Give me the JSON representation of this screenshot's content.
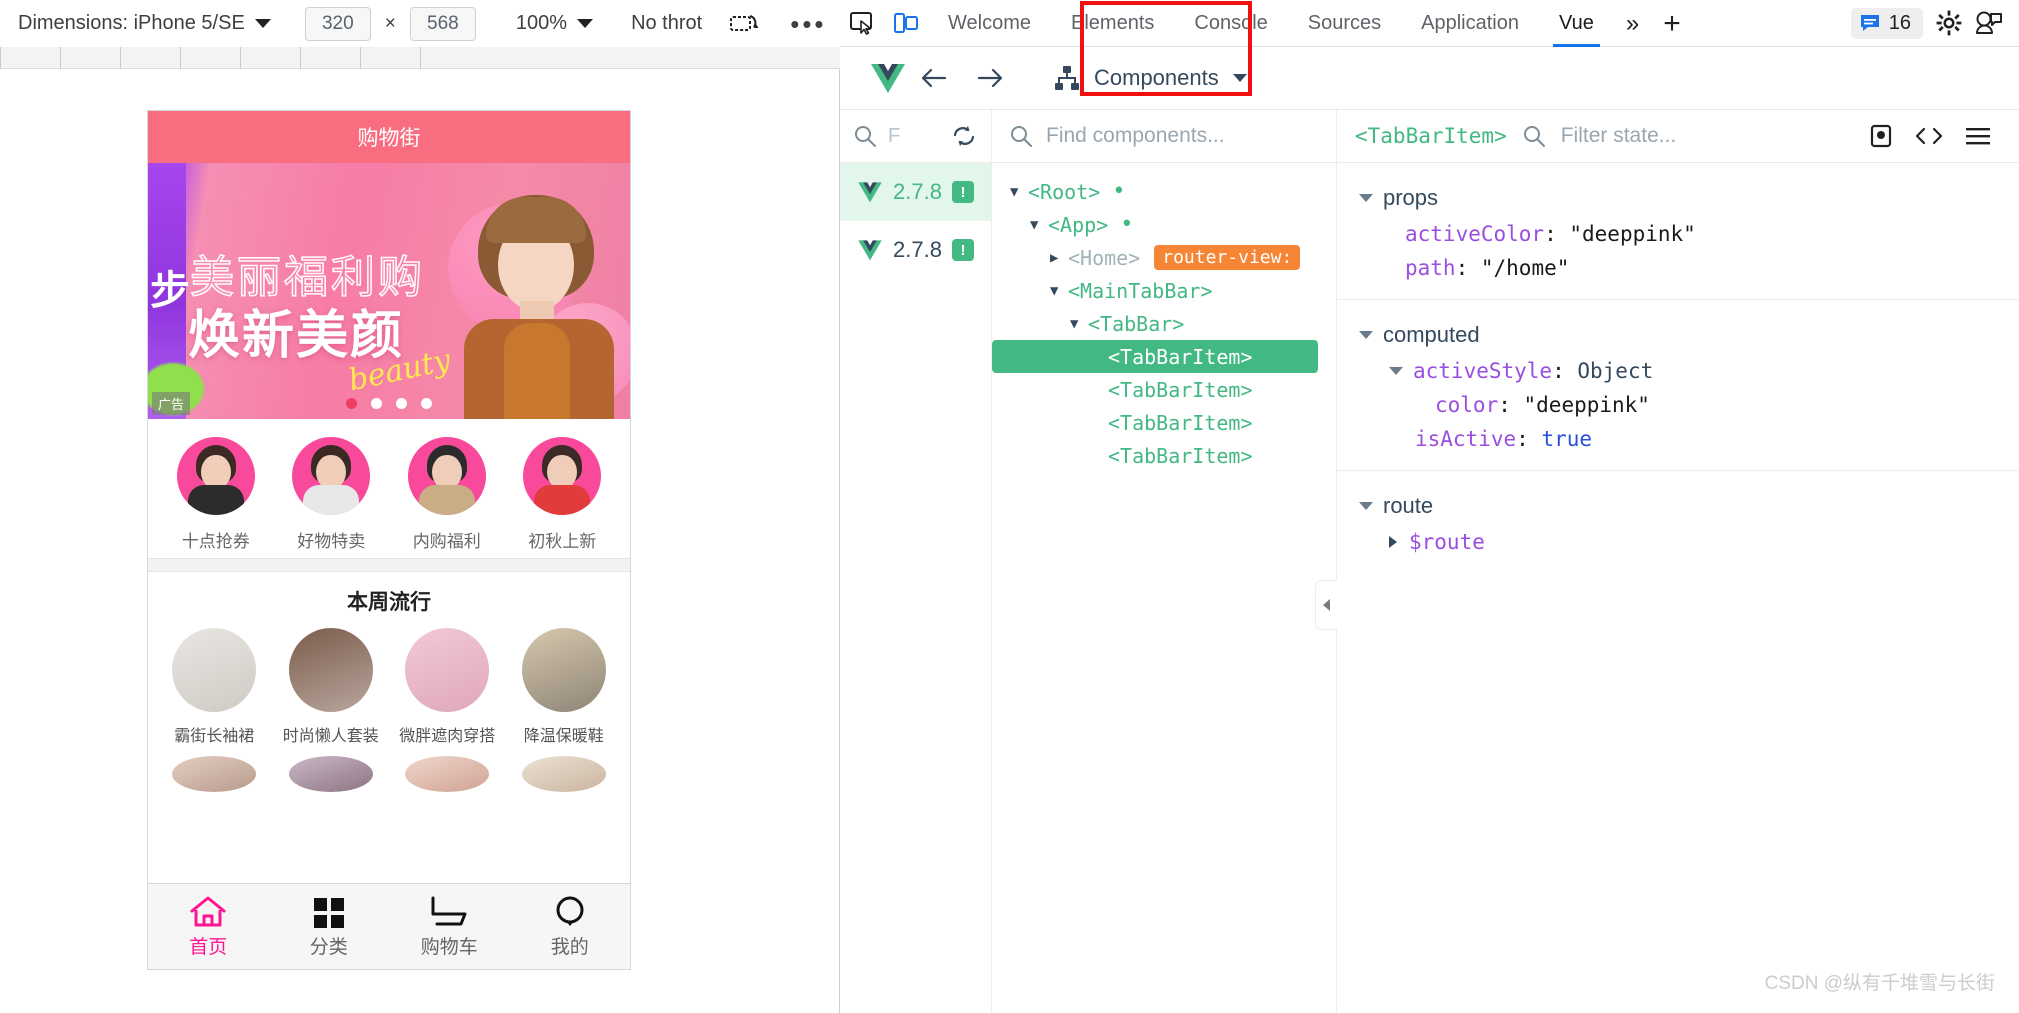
{
  "device_toolbar": {
    "dimensions_label": "Dimensions: iPhone 5/SE",
    "width_value": "320",
    "multiply": "×",
    "height_value": "568",
    "zoom_value": "100%",
    "throttle_label": "No throt",
    "rotate_icon": "rotate-device-icon",
    "more_icon": "more-options-icon"
  },
  "phone": {
    "header_title": "购物街",
    "banner": {
      "headline_outline": "美丽福利购",
      "headline_solid": "焕新美颜",
      "script_text": "beauty",
      "ad_label": "广告",
      "purple_glyph": "步",
      "dot_count": 4,
      "active_dot": 0
    },
    "categories": [
      {
        "label": "十点抢券"
      },
      {
        "label": "好物特卖"
      },
      {
        "label": "内购福利"
      },
      {
        "label": "初秋上新"
      }
    ],
    "popular_title": "本周流行",
    "popular": [
      {
        "label": "霸街长袖裙"
      },
      {
        "label": "时尚懒人套装"
      },
      {
        "label": "微胖遮肉穿搭"
      },
      {
        "label": "降温保暖鞋"
      }
    ],
    "tabbar": [
      {
        "label": "首页",
        "icon": "home-icon",
        "active": true
      },
      {
        "label": "分类",
        "icon": "grid-icon",
        "active": false
      },
      {
        "label": "购物车",
        "icon": "cart-icon",
        "active": false
      },
      {
        "label": "我的",
        "icon": "profile-icon",
        "active": false
      }
    ],
    "active_color": "#ff1493"
  },
  "devtools": {
    "inspect_icon": "inspect-element-icon",
    "device_toggle_icon": "device-toolbar-icon",
    "tabs": [
      {
        "label": "Welcome",
        "active": false
      },
      {
        "label": "Elements",
        "active": false
      },
      {
        "label": "Console",
        "active": false
      },
      {
        "label": "Sources",
        "active": false
      },
      {
        "label": "Application",
        "active": false
      },
      {
        "label": "Vue",
        "active": true
      }
    ],
    "overflow_label": "»",
    "add_tab_label": "+",
    "message_count": "16",
    "settings_icon": "gear-icon",
    "feedback_icon": "feedback-icon",
    "highlight_color": "#f01010"
  },
  "vue": {
    "logo": "vue-logo-icon",
    "back_icon": "arrow-left-icon",
    "forward_icon": "arrow-right-icon",
    "panel_selector": "Components",
    "apps": {
      "search_char": "F",
      "refresh_icon": "refresh-icon",
      "items": [
        {
          "version": "2.7.8",
          "selected": true,
          "badge": "!"
        },
        {
          "version": "2.7.8",
          "selected": false,
          "badge": "!"
        }
      ]
    },
    "tree": {
      "search_placeholder": "Find components...",
      "nodes": [
        {
          "label": "<Root>",
          "depth": 0,
          "arrow": "down",
          "dot": true,
          "selected": false,
          "badge": ""
        },
        {
          "label": "<App>",
          "depth": 1,
          "arrow": "down",
          "dot": true,
          "selected": false,
          "badge": ""
        },
        {
          "label": "<Home>",
          "depth": 2,
          "arrow": "right",
          "dot": false,
          "selected": false,
          "badge": "router-view:"
        },
        {
          "label": "<MainTabBar>",
          "depth": 2,
          "arrow": "down",
          "dot": false,
          "selected": false,
          "badge": ""
        },
        {
          "label": "<TabBar>",
          "depth": 3,
          "arrow": "down",
          "dot": false,
          "selected": false,
          "badge": ""
        },
        {
          "label": "<TabBarItem>",
          "depth": 4,
          "arrow": "none",
          "dot": false,
          "selected": true,
          "badge": ""
        },
        {
          "label": "<TabBarItem>",
          "depth": 4,
          "arrow": "none",
          "dot": false,
          "selected": false,
          "badge": ""
        },
        {
          "label": "<TabBarItem>",
          "depth": 4,
          "arrow": "none",
          "dot": false,
          "selected": false,
          "badge": ""
        },
        {
          "label": "<TabBarItem>",
          "depth": 4,
          "arrow": "none",
          "dot": false,
          "selected": false,
          "badge": ""
        }
      ],
      "collapse_icon": "collapse-left-icon"
    },
    "state": {
      "selected_component": "<TabBarItem>",
      "filter_placeholder": "Filter state...",
      "toolbar_icons": [
        "inspect-dom-icon",
        "open-in-editor-icon",
        "menu-icon"
      ],
      "groups": [
        {
          "name": "props",
          "rows": [
            {
              "key": "activeColor",
              "sep": ": ",
              "value": "\"deeppink\"",
              "type": "string",
              "indent": 1,
              "arrow": "none"
            },
            {
              "key": "path",
              "sep": ": ",
              "value": "\"/home\"",
              "type": "string",
              "indent": 1,
              "arrow": "none"
            }
          ]
        },
        {
          "name": "computed",
          "rows": [
            {
              "key": "activeStyle",
              "sep": ": ",
              "value": "Object",
              "type": "object",
              "indent": 1,
              "arrow": "down"
            },
            {
              "key": "color",
              "sep": ": ",
              "value": "\"deeppink\"",
              "type": "string",
              "indent": 2,
              "arrow": "none"
            },
            {
              "key": "isActive",
              "sep": ": ",
              "value": "true",
              "type": "bool",
              "indent": 1,
              "arrow": "none"
            }
          ]
        },
        {
          "name": "route",
          "rows": [
            {
              "key": "$route",
              "sep": "",
              "value": "",
              "type": "object",
              "indent": 1,
              "arrow": "right"
            }
          ]
        }
      ]
    }
  },
  "watermark": "CSDN @纵有千堆雪与长街"
}
